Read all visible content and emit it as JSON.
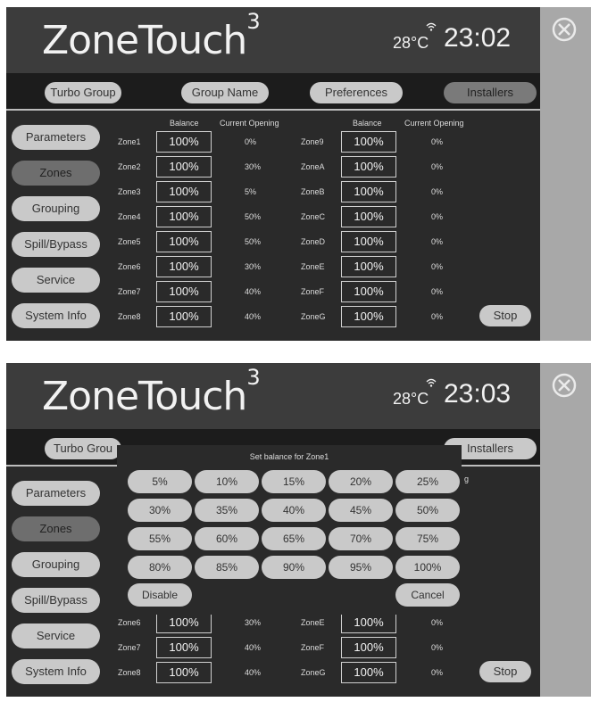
{
  "screen1": {
    "header": {
      "logo": "ZoneTouch",
      "logo_sup": "3",
      "temp": "28°C",
      "time": "23:02"
    },
    "topnav": [
      "Turbo Group",
      "Group Name",
      "Preferences",
      "Installers"
    ],
    "sidebar": [
      "Parameters",
      "Zones",
      "Grouping",
      "Spill/Bypass",
      "Service",
      "System Info"
    ],
    "col_heads": {
      "balance": "Balance",
      "opening": "Current Opening"
    },
    "zones_left": [
      {
        "name": "Zone1",
        "balance": "100%",
        "opening": "0%"
      },
      {
        "name": "Zone2",
        "balance": "100%",
        "opening": "30%"
      },
      {
        "name": "Zone3",
        "balance": "100%",
        "opening": "5%"
      },
      {
        "name": "Zone4",
        "balance": "100%",
        "opening": "50%"
      },
      {
        "name": "Zone5",
        "balance": "100%",
        "opening": "50%"
      },
      {
        "name": "Zone6",
        "balance": "100%",
        "opening": "30%"
      },
      {
        "name": "Zone7",
        "balance": "100%",
        "opening": "40%"
      },
      {
        "name": "Zone8",
        "balance": "100%",
        "opening": "40%"
      }
    ],
    "zones_right": [
      {
        "name": "Zone9",
        "balance": "100%",
        "opening": "0%"
      },
      {
        "name": "ZoneA",
        "balance": "100%",
        "opening": "0%"
      },
      {
        "name": "ZoneB",
        "balance": "100%",
        "opening": "0%"
      },
      {
        "name": "ZoneC",
        "balance": "100%",
        "opening": "0%"
      },
      {
        "name": "ZoneD",
        "balance": "100%",
        "opening": "0%"
      },
      {
        "name": "ZoneE",
        "balance": "100%",
        "opening": "0%"
      },
      {
        "name": "ZoneF",
        "balance": "100%",
        "opening": "0%"
      },
      {
        "name": "ZoneG",
        "balance": "100%",
        "opening": "0%"
      }
    ],
    "stop": "Stop"
  },
  "screen2": {
    "header": {
      "logo": "ZoneTouch",
      "logo_sup": "3",
      "temp": "28°C",
      "time": "23:03"
    },
    "topnav_visible": [
      "Turbo Grou",
      "Installers"
    ],
    "sidebar": [
      "Parameters",
      "Zones",
      "Grouping",
      "Spill/Bypass",
      "Service",
      "System Info"
    ],
    "zones_left": [
      {
        "name": "Zone6",
        "balance": "100%",
        "opening": "30%"
      },
      {
        "name": "Zone7",
        "balance": "100%",
        "opening": "40%"
      },
      {
        "name": "Zone8",
        "balance": "100%",
        "opening": "40%"
      }
    ],
    "zones_right": [
      {
        "name": "ZoneE",
        "balance": "100%",
        "opening": "0%"
      },
      {
        "name": "ZoneF",
        "balance": "100%",
        "opening": "0%"
      },
      {
        "name": "ZoneG",
        "balance": "100%",
        "opening": "0%"
      }
    ],
    "partial_text": "g",
    "stop": "Stop",
    "modal": {
      "title": "Set balance for Zone1",
      "options": [
        "5%",
        "10%",
        "15%",
        "20%",
        "25%",
        "30%",
        "35%",
        "40%",
        "45%",
        "50%",
        "55%",
        "60%",
        "65%",
        "70%",
        "75%",
        "80%",
        "85%",
        "90%",
        "95%",
        "100%"
      ],
      "disable": "Disable",
      "cancel": "Cancel"
    }
  },
  "icons": {
    "close": "close-circle-icon",
    "wifi": "wifi-icon"
  },
  "colors": {
    "panel": "#2a2a2a",
    "header": "#3c3c3c",
    "button": "#c9c9c9",
    "active": "#6e6e6e",
    "strip": "#a8a8a8"
  }
}
